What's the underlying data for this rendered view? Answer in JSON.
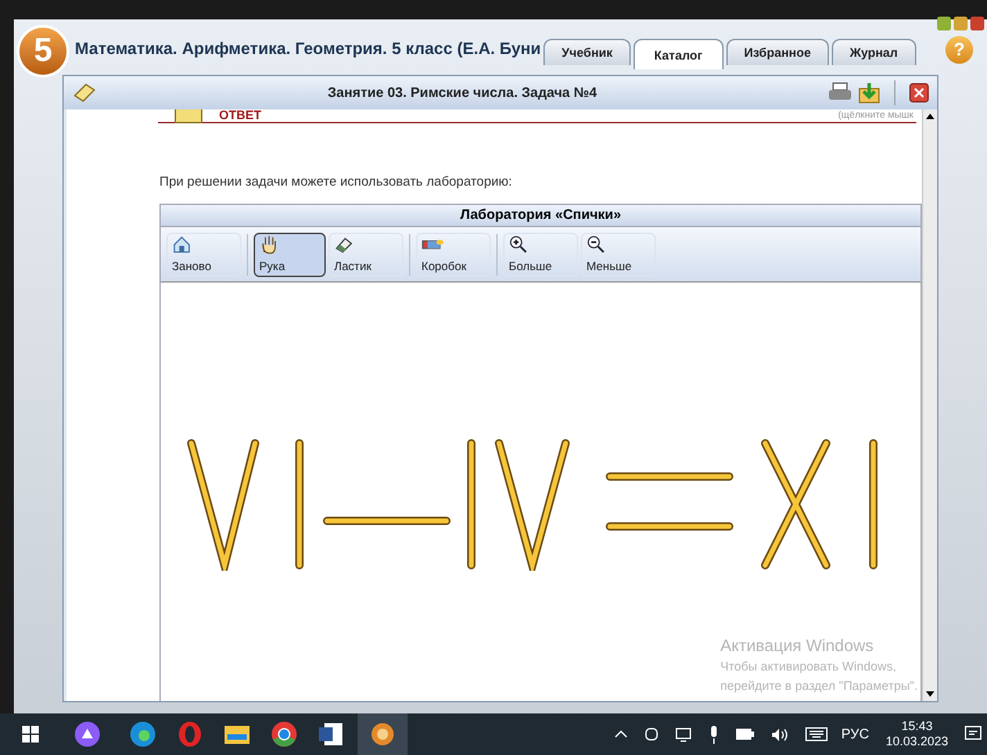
{
  "app": {
    "badge": "5",
    "title": "Математика. Арифметика. Геометрия. 5 класс (Е.А. Буни",
    "help": "?"
  },
  "tabs": [
    {
      "label": "Учебник",
      "selected": false
    },
    {
      "label": "Каталог",
      "selected": true
    },
    {
      "label": "Избранное",
      "selected": false
    },
    {
      "label": "Журнал",
      "selected": false
    }
  ],
  "lesson": {
    "title": "Занятие 03. Римские числа. Задача №4",
    "answer_heading": "ОТВЕТ",
    "hint": "(щёлкните мышк",
    "intro": "При решении задачи можете использовать лабораторию:"
  },
  "lab": {
    "title": "Лаборатория «Спички»",
    "tools": [
      {
        "kind": "home",
        "label": "Заново",
        "selected": false
      },
      {
        "kind": "hand",
        "label": "Рука",
        "selected": true
      },
      {
        "kind": "eraser",
        "label": "Ластик",
        "selected": false
      },
      {
        "kind": "box",
        "label": "Коробок",
        "selected": false
      },
      {
        "kind": "zoomin",
        "label": "Больше",
        "selected": false
      },
      {
        "kind": "zoomout",
        "label": "Меньше",
        "selected": false
      }
    ]
  },
  "activation": {
    "title": "Активация Windows",
    "line_1": "Чтобы активировать Windows,",
    "line_2": "перейдите в раздел \"Параметры\"."
  },
  "taskbar": {
    "language": "РУС",
    "time": "15:43",
    "date": "10.03.2023"
  }
}
